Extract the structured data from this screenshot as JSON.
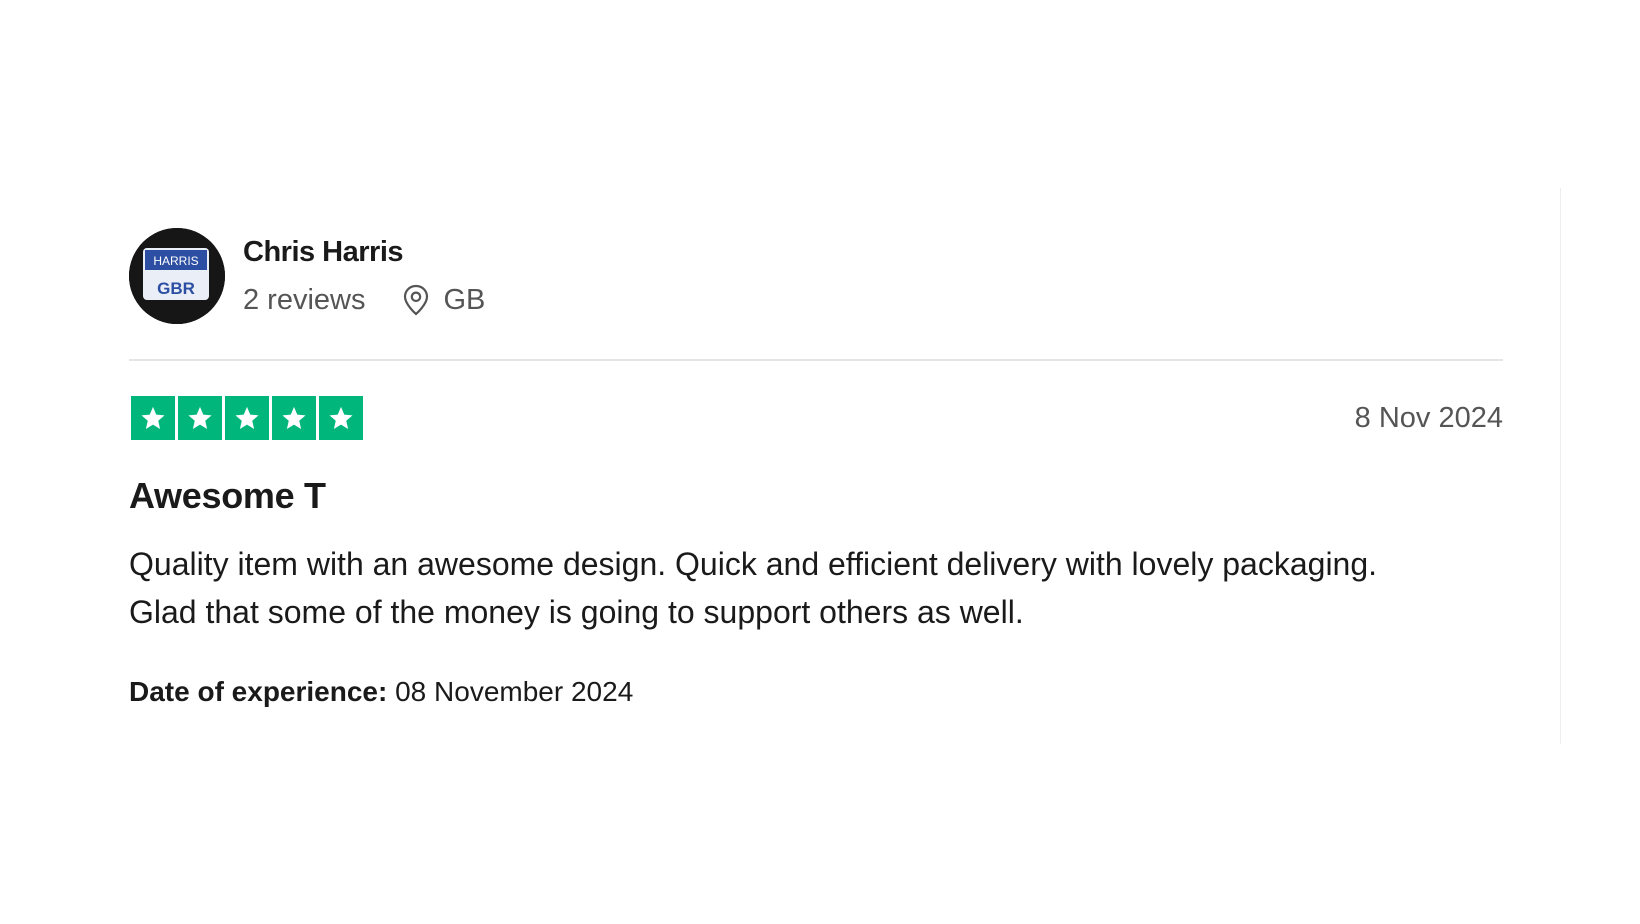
{
  "reviewer": {
    "name": "Chris Harris",
    "review_count": "2 reviews",
    "country": "GB",
    "avatar_text_top": "HARRIS",
    "avatar_text_bottom": "GBR"
  },
  "review": {
    "rating": 5,
    "rating_max": 5,
    "date": "8 Nov 2024",
    "title": "Awesome T",
    "body": "Quality item with an awesome design. Quick and efficient delivery with lovely packaging. Glad that some of the money is going to support others as well.",
    "experience_label": "Date of experience:",
    "experience_date": "08 November 2024"
  },
  "icons": {
    "location": "location-pin-icon",
    "star": "star-icon"
  },
  "colors": {
    "star_green": "#00b67a",
    "text_primary": "#1a1a1a",
    "text_secondary": "#555555",
    "divider": "#e5e5e5"
  }
}
